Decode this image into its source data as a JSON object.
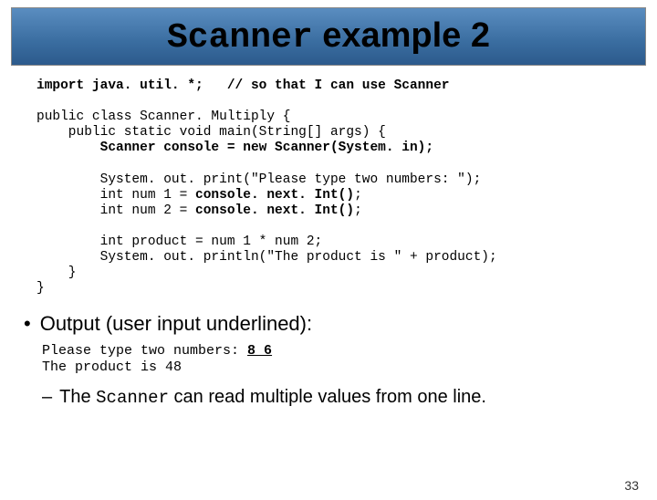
{
  "title": {
    "part1": "Scanner",
    "part2": " example 2"
  },
  "code": {
    "line1a": "import java. util. *;",
    "line1b": "// so that I can use Scanner",
    "line2": "public class Scanner. Multiply {",
    "line3": "    public static void main(String[] args) {",
    "line4": "        Scanner console = new Scanner(System. in);",
    "line5": "        System. out. print(\"Please type two numbers: \");",
    "line6a": "        int num 1 = ",
    "line6b": "console. next. Int()",
    "line6c": ";",
    "line7a": "        int num 2 = ",
    "line7b": "console. next. Int()",
    "line7c": ";",
    "line8": "        int product = num 1 * num 2;",
    "line9": "        System. out. println(\"The product is \" + product);",
    "line10": "    }",
    "line11": "}"
  },
  "bullet": "Output (user input underlined):",
  "output": {
    "line1a": "Please type two numbers: ",
    "line1b": "8 6",
    "line2": "The product is 48"
  },
  "dash": {
    "pre": "The ",
    "mono": "Scanner",
    "post": " can read multiple values from one line."
  },
  "pageNumber": "33"
}
